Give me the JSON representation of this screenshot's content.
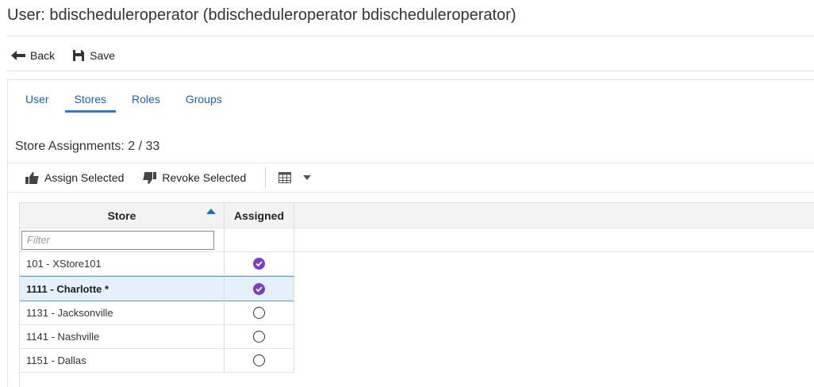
{
  "header": {
    "title": "User: bdischeduleroperator (bdischeduleroperator bdischeduleroperator)"
  },
  "toolbar": {
    "back_label": "Back",
    "save_label": "Save"
  },
  "tabs": [
    {
      "label": "User",
      "active": false
    },
    {
      "label": "Stores",
      "active": true
    },
    {
      "label": "Roles",
      "active": false
    },
    {
      "label": "Groups",
      "active": false
    }
  ],
  "section": {
    "title": "Store Assignments: 2 / 33"
  },
  "grid_toolbar": {
    "assign_label": "Assign Selected",
    "revoke_label": "Revoke Selected"
  },
  "grid": {
    "columns": [
      "Store",
      "Assigned"
    ],
    "filter_placeholder": "Filter",
    "rows": [
      {
        "store": "101 - XStore101",
        "assigned": true,
        "selected": false
      },
      {
        "store": "1111 - Charlotte *",
        "assigned": true,
        "selected": true
      },
      {
        "store": "1131 - Jacksonville",
        "assigned": false,
        "selected": false
      },
      {
        "store": "1141 - Nashville",
        "assigned": false,
        "selected": false
      },
      {
        "store": "1151 - Dallas",
        "assigned": false,
        "selected": false
      }
    ]
  },
  "colors": {
    "accent": "#2a7dd6",
    "assigned_check": "#7b3fbf",
    "selected_row": "#e4f0fb"
  }
}
